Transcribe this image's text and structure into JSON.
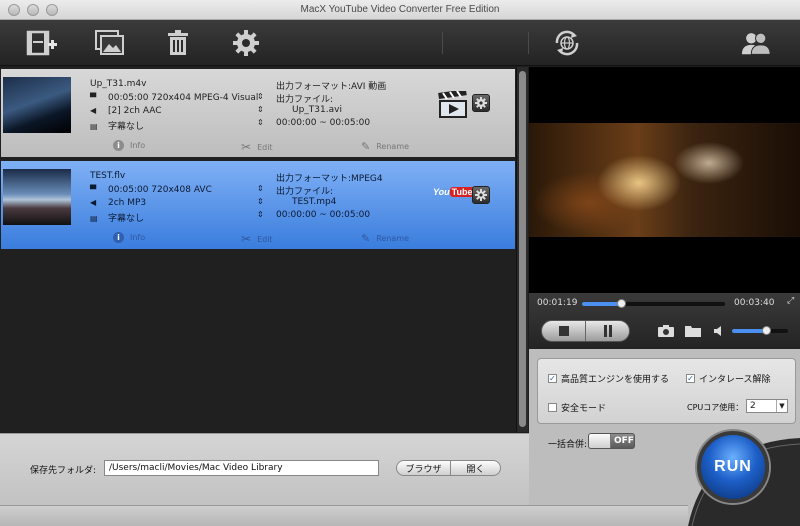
{
  "window": {
    "title": "MacX YouTube Video Converter Free Edition"
  },
  "files": [
    {
      "name": "Up_T31.m4v",
      "video": "00:05:00 720x404 MPEG-4 Visual",
      "audio": "[2] 2ch AAC",
      "subtitle": "字幕なし",
      "output_format": "出力フォーマット:AVI 動画",
      "output_file_label": "出力ファイル:",
      "output_file": "Up_T31.avi",
      "range": "00:00:00 ~ 00:05:00",
      "format_icon": "clapperboard-icon",
      "selected": false
    },
    {
      "name": "TEST.flv",
      "video": "00:05:00 720x408 AVC",
      "audio": "2ch MP3",
      "subtitle": "字幕なし",
      "output_format": "出力フォーマット:MPEG4",
      "output_file_label": "出力ファイル:",
      "output_file": "TEST.mp4",
      "range": "00:00:00 ~ 00:05:00",
      "format_icon": "youtube-icon",
      "selected": true
    }
  ],
  "row_actions": {
    "info": "Info",
    "edit": "Edit",
    "rename": "Rename"
  },
  "youtube_logo": {
    "you": "You",
    "tube": "Tube"
  },
  "player": {
    "current_time": "00:01:19",
    "total_time": "00:03:40",
    "progress": 0.27,
    "volume": 0.6
  },
  "options": {
    "hq_engine": {
      "label": "高品質エンジンを使用する",
      "checked": true
    },
    "deinterlace": {
      "label": "インタレース解除",
      "checked": true
    },
    "safe_mode": {
      "label": "安全モード",
      "checked": false
    },
    "cpu_label": "CPUコア使用：",
    "cpu_value": "2",
    "merge_label": "一括合併:",
    "merge_state": "OFF"
  },
  "run_label": "RUN",
  "save": {
    "label": "保存先フォルダ:",
    "path": "/Users/macli/Movies/Mac Video Library",
    "browse": "ブラウザ",
    "open": "開く"
  },
  "colors": {
    "accent": "#3a7ddd",
    "run": "#1d5fc8"
  }
}
